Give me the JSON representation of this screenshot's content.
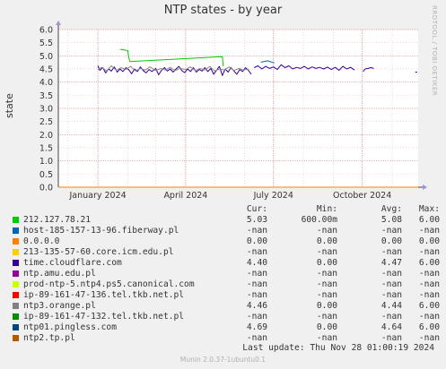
{
  "title": "NTP states - by year",
  "watermark": "RRDTOOL / TOBI OETIKER",
  "chart_data": {
    "type": "line",
    "title": "NTP states - by year",
    "ylabel": "state",
    "ylim": [
      0,
      6
    ],
    "yticks": [
      "0.0",
      "0.5",
      "1.0",
      "1.5",
      "2.0",
      "2.5",
      "3.0",
      "3.5",
      "4.0",
      "4.5",
      "5.0",
      "5.5",
      "6.0"
    ],
    "x_range": [
      "2023-11-21",
      "2024-11-28"
    ],
    "xticks": [
      {
        "date": "2024-01-01",
        "label": "January 2024"
      },
      {
        "date": "2024-04-01",
        "label": "April 2024"
      },
      {
        "date": "2024-07-01",
        "label": "July 2024"
      },
      {
        "date": "2024-10-01",
        "label": "October 2024"
      }
    ],
    "grid": true,
    "series": [
      {
        "name": "212.127.78.21",
        "color": "#00cc00",
        "values": [
          [
            "2024-01-24",
            5.25
          ],
          [
            "2024-02-01",
            5.2
          ],
          [
            "2024-02-02",
            4.95
          ],
          [
            "2024-02-03",
            4.78
          ],
          [
            "2024-05-09",
            4.97
          ],
          [
            "2024-05-10",
            4.6
          ]
        ]
      },
      {
        "name": "time.cloudflare.com",
        "color": "#330099",
        "values": [
          [
            "2024-01-01",
            4.62
          ],
          [
            "2024-01-03",
            4.45
          ],
          [
            "2024-01-06",
            4.55
          ],
          [
            "2024-01-09",
            4.35
          ],
          [
            "2024-01-12",
            4.5
          ],
          [
            "2024-01-15",
            4.42
          ],
          [
            "2024-01-18",
            4.58
          ],
          [
            "2024-01-21",
            4.38
          ],
          [
            "2024-01-24",
            4.5
          ],
          [
            "2024-01-27",
            4.4
          ],
          [
            "2024-01-30",
            4.55
          ],
          [
            "2024-02-02",
            4.47
          ],
          [
            "2024-02-05",
            4.32
          ],
          [
            "2024-02-08",
            4.5
          ],
          [
            "2024-02-11",
            4.4
          ],
          [
            "2024-02-14",
            4.58
          ],
          [
            "2024-02-17",
            4.44
          ],
          [
            "2024-02-20",
            4.35
          ],
          [
            "2024-02-23",
            4.48
          ],
          [
            "2024-02-26",
            4.4
          ],
          [
            "2024-03-01",
            4.52
          ],
          [
            "2024-03-04",
            4.28
          ],
          [
            "2024-03-07",
            4.45
          ],
          [
            "2024-03-10",
            4.55
          ],
          [
            "2024-03-13",
            4.42
          ],
          [
            "2024-03-16",
            4.5
          ],
          [
            "2024-03-19",
            4.38
          ],
          [
            "2024-03-22",
            4.5
          ],
          [
            "2024-03-25",
            4.6
          ],
          [
            "2024-03-28",
            4.44
          ],
          [
            "2024-03-31",
            4.36
          ],
          [
            "2024-04-03",
            4.5
          ],
          [
            "2024-04-06",
            4.4
          ],
          [
            "2024-04-09",
            4.55
          ],
          [
            "2024-04-12",
            4.38
          ],
          [
            "2024-04-15",
            4.48
          ],
          [
            "2024-04-18",
            4.42
          ],
          [
            "2024-04-21",
            4.55
          ],
          [
            "2024-04-24",
            4.4
          ],
          [
            "2024-04-27",
            4.52
          ],
          [
            "2024-04-30",
            4.3
          ],
          [
            "2024-05-03",
            4.45
          ],
          [
            "2024-05-06",
            4.6
          ],
          [
            "2024-05-09",
            4.25
          ],
          [
            "2024-05-12",
            4.5
          ],
          [
            "2024-05-15",
            4.38
          ],
          [
            "2024-05-18",
            4.55
          ],
          [
            "2024-05-21",
            4.42
          ],
          [
            "2024-05-24",
            4.3
          ],
          [
            "2024-05-27",
            4.48
          ],
          [
            "2024-05-30",
            4.4
          ],
          [
            "2024-06-02",
            4.55
          ],
          [
            "2024-06-05",
            4.45
          ],
          [
            "2024-06-08",
            4.3
          ]
        ]
      },
      {
        "name": "ntp3.orange.pl",
        "color": "#888888",
        "values": [
          [
            "2024-01-01",
            4.48
          ],
          [
            "2024-01-05",
            4.56
          ],
          [
            "2024-01-10",
            4.43
          ],
          [
            "2024-01-15",
            4.62
          ],
          [
            "2024-01-20",
            4.45
          ],
          [
            "2024-01-25",
            4.55
          ],
          [
            "2024-01-30",
            4.48
          ],
          [
            "2024-02-04",
            4.6
          ],
          [
            "2024-02-09",
            4.42
          ],
          [
            "2024-02-14",
            4.52
          ],
          [
            "2024-02-19",
            4.46
          ],
          [
            "2024-02-24",
            4.58
          ],
          [
            "2024-03-01",
            4.44
          ],
          [
            "2024-03-06",
            4.52
          ],
          [
            "2024-03-11",
            4.46
          ],
          [
            "2024-03-16",
            4.56
          ],
          [
            "2024-03-21",
            4.44
          ],
          [
            "2024-03-26",
            4.52
          ],
          [
            "2024-04-01",
            4.48
          ],
          [
            "2024-04-06",
            4.58
          ],
          [
            "2024-04-11",
            4.44
          ],
          [
            "2024-04-16",
            4.52
          ],
          [
            "2024-04-21",
            4.46
          ],
          [
            "2024-04-26",
            4.6
          ],
          [
            "2024-05-01",
            4.42
          ],
          [
            "2024-05-06",
            4.5
          ],
          [
            "2024-05-11",
            4.46
          ],
          [
            "2024-05-16",
            4.58
          ],
          [
            "2024-05-21",
            4.44
          ],
          [
            "2024-05-26",
            4.52
          ],
          [
            "2024-05-31",
            4.46
          ],
          [
            "2024-06-05",
            4.5
          ]
        ]
      },
      {
        "name": "ntp01.pingless.com",
        "color": "#0066b3",
        "values": [
          [
            "2024-06-18",
            4.76
          ],
          [
            "2024-06-25",
            4.81
          ],
          [
            "2024-07-02",
            4.73
          ]
        ]
      },
      {
        "name": "ntp01.pingless.com",
        "color": "#330099",
        "values": [
          [
            "2024-06-11",
            4.55
          ],
          [
            "2024-06-15",
            4.62
          ],
          [
            "2024-06-19",
            4.5
          ],
          [
            "2024-06-23",
            4.6
          ],
          [
            "2024-06-27",
            4.52
          ],
          [
            "2024-07-01",
            4.58
          ],
          [
            "2024-07-05",
            4.48
          ],
          [
            "2024-07-09",
            4.66
          ],
          [
            "2024-07-13",
            4.55
          ],
          [
            "2024-07-17",
            4.62
          ],
          [
            "2024-07-21",
            4.5
          ],
          [
            "2024-07-25",
            4.56
          ],
          [
            "2024-07-29",
            4.52
          ],
          [
            "2024-08-02",
            4.6
          ],
          [
            "2024-08-06",
            4.5
          ],
          [
            "2024-08-10",
            4.58
          ],
          [
            "2024-08-14",
            4.52
          ],
          [
            "2024-08-18",
            4.56
          ],
          [
            "2024-08-22",
            4.5
          ],
          [
            "2024-08-26",
            4.57
          ],
          [
            "2024-08-30",
            4.48
          ],
          [
            "2024-09-03",
            4.56
          ],
          [
            "2024-09-07",
            4.45
          ],
          [
            "2024-09-11",
            4.6
          ],
          [
            "2024-09-15",
            4.5
          ],
          [
            "2024-09-19",
            4.56
          ],
          [
            "2024-09-23",
            4.46
          ]
        ]
      },
      {
        "name": "ntp01.pingless.com",
        "color": "#330099",
        "values": [
          [
            "2024-10-02",
            4.4
          ],
          [
            "2024-10-04",
            4.5
          ],
          [
            "2024-10-07",
            4.52
          ],
          [
            "2024-10-10",
            4.55
          ],
          [
            "2024-10-13",
            4.52
          ]
        ]
      },
      {
        "name": "ntp01.pingless.com",
        "color": "#330099",
        "values": [
          [
            "2024-11-25",
            4.38
          ],
          [
            "2024-11-27",
            4.38
          ]
        ]
      }
    ]
  },
  "legend": {
    "headers": {
      "cur": "Cur:",
      "min": "Min:",
      "avg": "Avg:",
      "max": "Max:"
    },
    "rows": [
      {
        "name": "212.127.78.21",
        "color": "#00cc00",
        "cur": "5.03",
        "min": "600.00m",
        "avg": "5.08",
        "max": "6.00"
      },
      {
        "name": "host-185-157-13-96.fiberway.pl",
        "color": "#0066b3",
        "cur": "-nan",
        "min": "-nan",
        "avg": "-nan",
        "max": "-nan"
      },
      {
        "name": "0.0.0.0",
        "color": "#ff8000",
        "cur": "0.00",
        "min": "0.00",
        "avg": "0.00",
        "max": "0.00"
      },
      {
        "name": "213-135-57-60.core.icm.edu.pl",
        "color": "#ffcc00",
        "cur": "-nan",
        "min": "-nan",
        "avg": "-nan",
        "max": "-nan"
      },
      {
        "name": "time.cloudflare.com",
        "color": "#330099",
        "cur": "4.40",
        "min": "0.00",
        "avg": "4.47",
        "max": "6.00"
      },
      {
        "name": "ntp.amu.edu.pl",
        "color": "#990099",
        "cur": "-nan",
        "min": "-nan",
        "avg": "-nan",
        "max": "-nan"
      },
      {
        "name": "prod-ntp-5.ntp4.ps5.canonical.com",
        "color": "#ccff00",
        "cur": "-nan",
        "min": "-nan",
        "avg": "-nan",
        "max": "-nan"
      },
      {
        "name": "ip-89-161-47-136.tel.tkb.net.pl",
        "color": "#ff0000",
        "cur": "-nan",
        "min": "-nan",
        "avg": "-nan",
        "max": "-nan"
      },
      {
        "name": "ntp3.orange.pl",
        "color": "#808080",
        "cur": "4.46",
        "min": "0.00",
        "avg": "4.44",
        "max": "6.00"
      },
      {
        "name": "ip-89-161-47-132.tel.tkb.net.pl",
        "color": "#008f00",
        "cur": "-nan",
        "min": "-nan",
        "avg": "-nan",
        "max": "-nan"
      },
      {
        "name": "ntp01.pingless.com",
        "color": "#00487d",
        "cur": "4.69",
        "min": "0.00",
        "avg": "4.64",
        "max": "6.00"
      },
      {
        "name": "ntp2.tp.pl",
        "color": "#b35a00",
        "cur": "-nan",
        "min": "-nan",
        "avg": "-nan",
        "max": "-nan"
      }
    ]
  },
  "last_update": "Last update: Thu Nov 28 01:00:19 2024",
  "footer": "Munin 2.0.37-1ubuntu0.1"
}
